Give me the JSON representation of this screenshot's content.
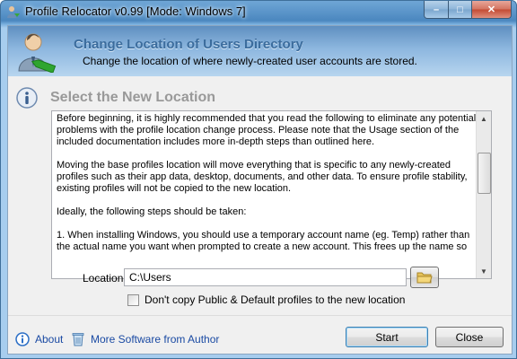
{
  "window": {
    "title": "Profile Relocator v0.99 [Mode: Windows 7]",
    "controls": {
      "minimize": "–",
      "maximize": "□",
      "close": "✕"
    }
  },
  "header": {
    "title": "Change Location of Users Directory",
    "subtitle": "Change the location of where newly-created user accounts are stored.",
    "icon": "user-arrow-icon"
  },
  "section": {
    "title": "Select the New Location",
    "icon": "info-icon",
    "paragraphs": [
      "Before beginning, it is highly recommended that you read the following to eliminate any potential problems with the profile location change process. Please note that the Usage section of the included documentation includes more in-depth steps than outlined here.",
      "Moving the base profiles location will move everything that is specific to any newly-created profiles such as their app data, desktop, documents, and other data. To ensure profile stability, existing profiles will not be copied to the new location.",
      "Ideally, the following steps should be taken:",
      "1. When installing Windows, you should use a temporary account name (eg. Temp) rather than the actual name you want when prompted to create a new account. This frees up the name so"
    ]
  },
  "location": {
    "label": "Location",
    "value": "C:\\Users",
    "browse_icon": "folder-icon"
  },
  "options": {
    "dont_copy_label": "Don't copy Public & Default profiles to the new location",
    "dont_copy_checked": false
  },
  "footer": {
    "about_label": "About",
    "more_software_label": "More Software from Author",
    "start_label": "Start",
    "close_label": "Close"
  },
  "colors": {
    "accent": "#3b6c9d",
    "link": "#1a4aa3",
    "section_title": "#999999"
  }
}
